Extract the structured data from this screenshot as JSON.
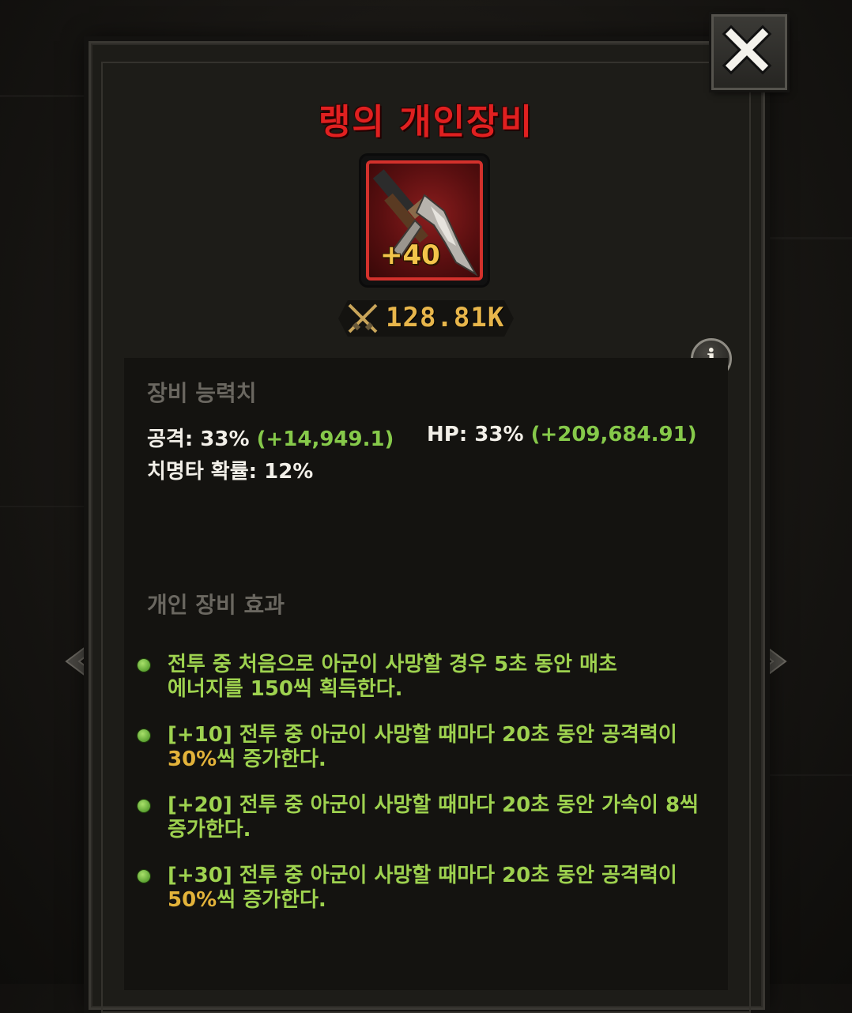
{
  "title": "랭의 개인장비",
  "item": {
    "level": "+40",
    "icon": "pickaxe-icon"
  },
  "power": {
    "value": "128.81K",
    "icon": "crossed-swords-icon"
  },
  "stats_section": {
    "label": "장비 능력치",
    "attack_label": "공격: 33%",
    "attack_bonus": "(+14,949.1)",
    "hp_label": "HP: 33%",
    "hp_bonus": "(+209,684.91)",
    "crit": "치명타 확률: 12%"
  },
  "effects_section": {
    "label": "개인 장비 효과",
    "effects": [
      {
        "line1": "전투 중 처음으로 아군이 사망할 경우 5초 동안 매초",
        "line2_pre": "",
        "line2_highlight": "",
        "line2_post": "에너지를 150씩 획득한다."
      },
      {
        "line1": "[+10] 전투 중 아군이 사망할 때마다 20초 동안 공격력이",
        "line2_pre": "",
        "line2_highlight": "30%",
        "line2_post": "씩 증가한다."
      },
      {
        "line1": "[+20] 전투 중 아군이 사망할 때마다 20초 동안 가속이 8씩",
        "line2_pre": "",
        "line2_highlight": "",
        "line2_post": "증가한다."
      },
      {
        "line1": "[+30] 전투 중 아군이 사망할 때마다 20초 동안 공격력이",
        "line2_pre": "",
        "line2_highlight": "50%",
        "line2_post": "씩 증가한다."
      }
    ]
  },
  "buttons": {
    "close": "close-icon",
    "info": "i"
  },
  "colors": {
    "title": "#e02020",
    "bonus": "#86c94a",
    "effect": "#9ed24f",
    "highlight": "#e3b33a",
    "level": "#f3c44a",
    "frame": "#d3312c"
  }
}
